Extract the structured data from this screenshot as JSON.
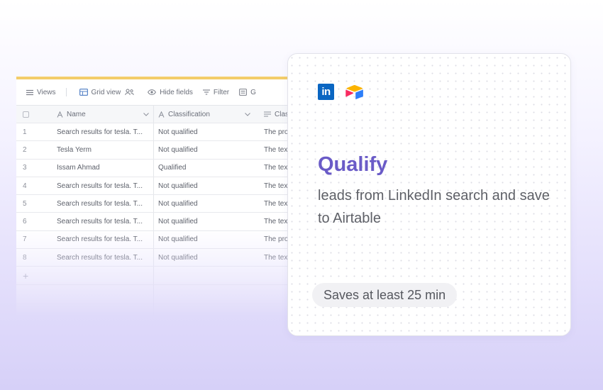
{
  "toolbar": {
    "views_label": "Views",
    "grid_view_label": "Grid view",
    "hide_fields_label": "Hide fields",
    "filter_label": "Filter",
    "truncated_label": "G"
  },
  "table": {
    "columns": {
      "name": "Name",
      "classification": "Classification",
      "class_truncated": "Class"
    },
    "rows": [
      {
        "num": "1",
        "name": "Search results for tesla. T...",
        "classification": "Not qualified",
        "text": "The prov"
      },
      {
        "num": "2",
        "name": "Tesla Yerm",
        "classification": "Not qualified",
        "text": "The text"
      },
      {
        "num": "3",
        "name": "Issam Ahmad",
        "classification": "Qualified",
        "text": "The text"
      },
      {
        "num": "4",
        "name": "Search results for tesla. T...",
        "classification": "Not qualified",
        "text": "The text"
      },
      {
        "num": "5",
        "name": "Search results for tesla. T...",
        "classification": "Not qualified",
        "text": "The text"
      },
      {
        "num": "6",
        "name": "Search results for tesla. T...",
        "classification": "Not qualified",
        "text": "The text"
      },
      {
        "num": "7",
        "name": "Search results for tesla. T...",
        "classification": "Not qualified",
        "text": "The prov"
      },
      {
        "num": "8",
        "name": "Search results for tesla. T...",
        "classification": "Not qualified",
        "text": "The text"
      }
    ],
    "add_label": "+"
  },
  "card": {
    "linkedin_logo_text": "in",
    "title": "Qualify",
    "description": "leads from LinkedIn search and save to Airtable",
    "badge": "Saves at least 25 min"
  },
  "colors": {
    "accent_purple": "#6a5bc7",
    "linkedin_blue": "#0a66c2",
    "airtable_yellow": "#fcb400",
    "airtable_red": "#f82b60",
    "airtable_blue": "#2d7ff9",
    "table_accent": "#f3cd6a"
  },
  "icons": [
    "list-icon",
    "grid-icon",
    "people-icon",
    "eye-icon",
    "filter-icon",
    "group-icon",
    "text-field-icon",
    "chevron-down-icon",
    "linkedin-logo",
    "airtable-logo"
  ]
}
